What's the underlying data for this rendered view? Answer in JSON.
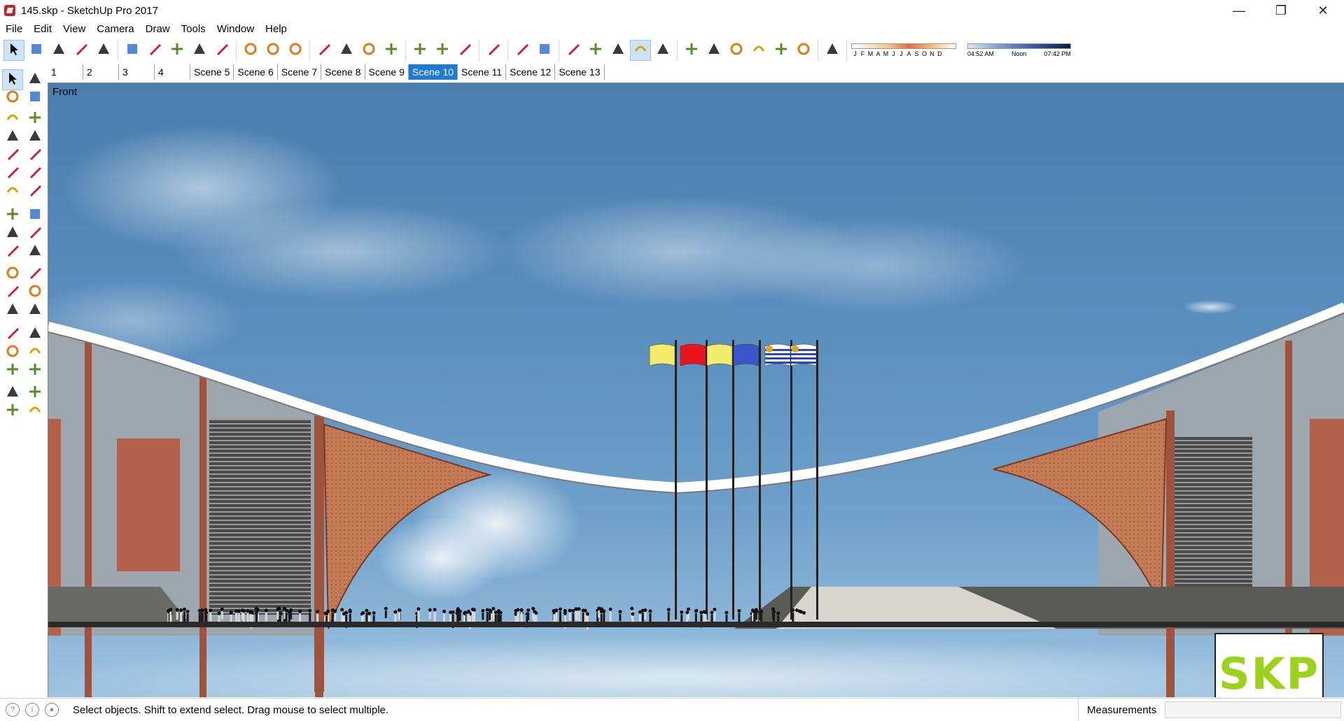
{
  "window": {
    "title": "145.skp - SketchUp Pro 2017",
    "controls": {
      "minimize": "—",
      "maximize": "❐",
      "close": "✕"
    }
  },
  "menu": [
    "File",
    "Edit",
    "View",
    "Camera",
    "Draw",
    "Tools",
    "Window",
    "Help"
  ],
  "toolbar": {
    "groups": [
      [
        "select-icon",
        "eraser-icon",
        "pencil-icon",
        "arc-icon",
        "rectangle-icon"
      ],
      [
        "push-pull-icon",
        "follow-me-icon",
        "move-icon",
        "rotate-icon",
        "scale-icon"
      ],
      [
        "tape-measure-icon",
        "text-icon",
        "paint-bucket-icon"
      ],
      [
        "orbit-icon",
        "pan-icon",
        "zoom-icon",
        "zoom-extents-icon"
      ],
      [
        "3d-warehouse-icon",
        "extension-warehouse-icon",
        "layout-icon"
      ],
      [
        "ruby-icon"
      ],
      [
        "xray-icon",
        "back-edges-icon"
      ],
      [
        "wireframe-icon",
        "hidden-line-icon",
        "shaded-icon",
        "shaded-textures-icon",
        "monochrome-icon"
      ],
      [
        "iso-view-icon",
        "top-view-icon",
        "front-view-icon",
        "right-view-icon",
        "back-view-icon",
        "left-view-icon"
      ],
      [
        "shadows-icon"
      ]
    ],
    "shadow_months": [
      "J",
      "F",
      "M",
      "A",
      "M",
      "J",
      "J",
      "A",
      "S",
      "O",
      "N",
      "D"
    ],
    "time_labels": {
      "start": "04:52 AM",
      "mid": "Noon",
      "end": "07:42 PM"
    }
  },
  "scene_tabs": [
    {
      "label": "1",
      "selected": false
    },
    {
      "label": "2",
      "selected": false
    },
    {
      "label": "3",
      "selected": false
    },
    {
      "label": "4",
      "selected": false
    },
    {
      "label": "Scene 5",
      "selected": false
    },
    {
      "label": "Scene 6",
      "selected": false
    },
    {
      "label": "Scene 7",
      "selected": false
    },
    {
      "label": "Scene 8",
      "selected": false
    },
    {
      "label": "Scene 9",
      "selected": false
    },
    {
      "label": "Scene 10",
      "selected": true
    },
    {
      "label": "Scene 11",
      "selected": false
    },
    {
      "label": "Scene 12",
      "selected": false
    },
    {
      "label": "Scene 13",
      "selected": false
    }
  ],
  "left_toolbar": [
    "select-icon",
    "component-icon",
    "paint-bucket-icon",
    "eraser-icon",
    "line-icon",
    "freehand-icon",
    "rectangle-icon",
    "rotated-rectangle-icon",
    "circle-icon",
    "polygon-icon",
    "arc-icon",
    "two-point-arc-icon",
    "pie-icon",
    "three-point-arc-icon",
    "move-icon",
    "push-pull-icon",
    "rotate-icon",
    "follow-me-icon",
    "scale-icon",
    "offset-icon",
    "tape-measure-icon",
    "dimension-icon",
    "protractor-icon",
    "text-icon",
    "axes-icon",
    "3d-text-icon",
    "orbit-icon",
    "pan-icon",
    "zoom-icon",
    "zoom-window-icon",
    "zoom-extents-icon",
    "previous-view-icon",
    "position-camera-icon",
    "look-around-icon",
    "walk-icon",
    "section-plane-icon"
  ],
  "viewport": {
    "view_label": "Front",
    "sky_color": "#5a8ebd",
    "flag_colors": [
      "#f2ea6a",
      "#e8141e",
      "#f2ea6a",
      "#3a56c8",
      "#ffffff",
      "#ffffff"
    ],
    "logo_text": "SKP"
  },
  "status": {
    "message": "Select objects. Shift to extend select. Drag mouse to select multiple.",
    "measurements_label": "Measurements",
    "measurements_value": ""
  }
}
